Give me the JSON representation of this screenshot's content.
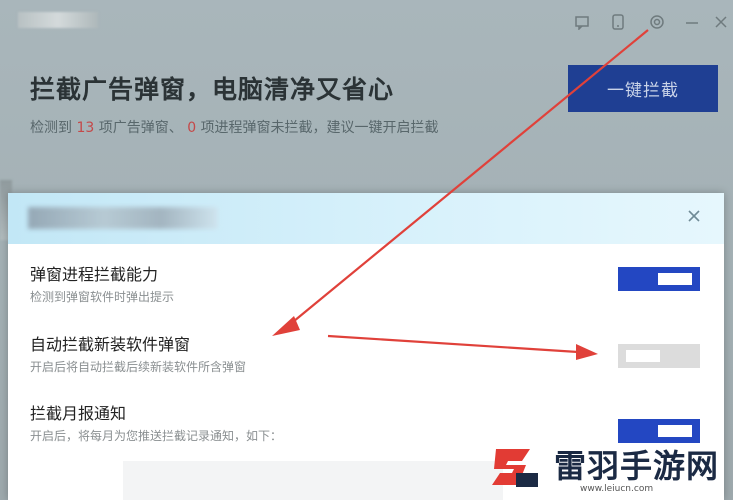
{
  "window": {
    "icons": [
      "feedback-icon",
      "phone-icon",
      "settings-icon",
      "minimize-icon",
      "close-icon"
    ]
  },
  "hero": {
    "title": "拦截广告弹窗，电脑清净又省心",
    "sub_prefix": "检测到",
    "ad_popup_count": "13",
    "sub_middle": "项广告弹窗、",
    "process_popup_count": "0",
    "sub_suffix": "项进程弹窗未拦截，建议一键开启拦截",
    "cta_label": "一键拦截"
  },
  "dialog": {
    "options": [
      {
        "title": "弹窗进程拦截能力",
        "desc": "检测到弹窗软件时弹出提示",
        "enabled": true
      },
      {
        "title": "自动拦截新装软件弹窗",
        "desc": "开启后将自动拦截后续新装软件所含弹窗",
        "enabled": false
      },
      {
        "title": "拦截月报通知",
        "desc": "开启后，将每月为您推送拦截记录通知，如下：",
        "enabled": true
      }
    ]
  },
  "watermark": {
    "brand": "雷羽手游网",
    "url": "www.leiucn.com"
  },
  "colors": {
    "accent": "#2347c2",
    "annotation_arrow": "#e0413a",
    "count_highlight": "#c44949"
  }
}
